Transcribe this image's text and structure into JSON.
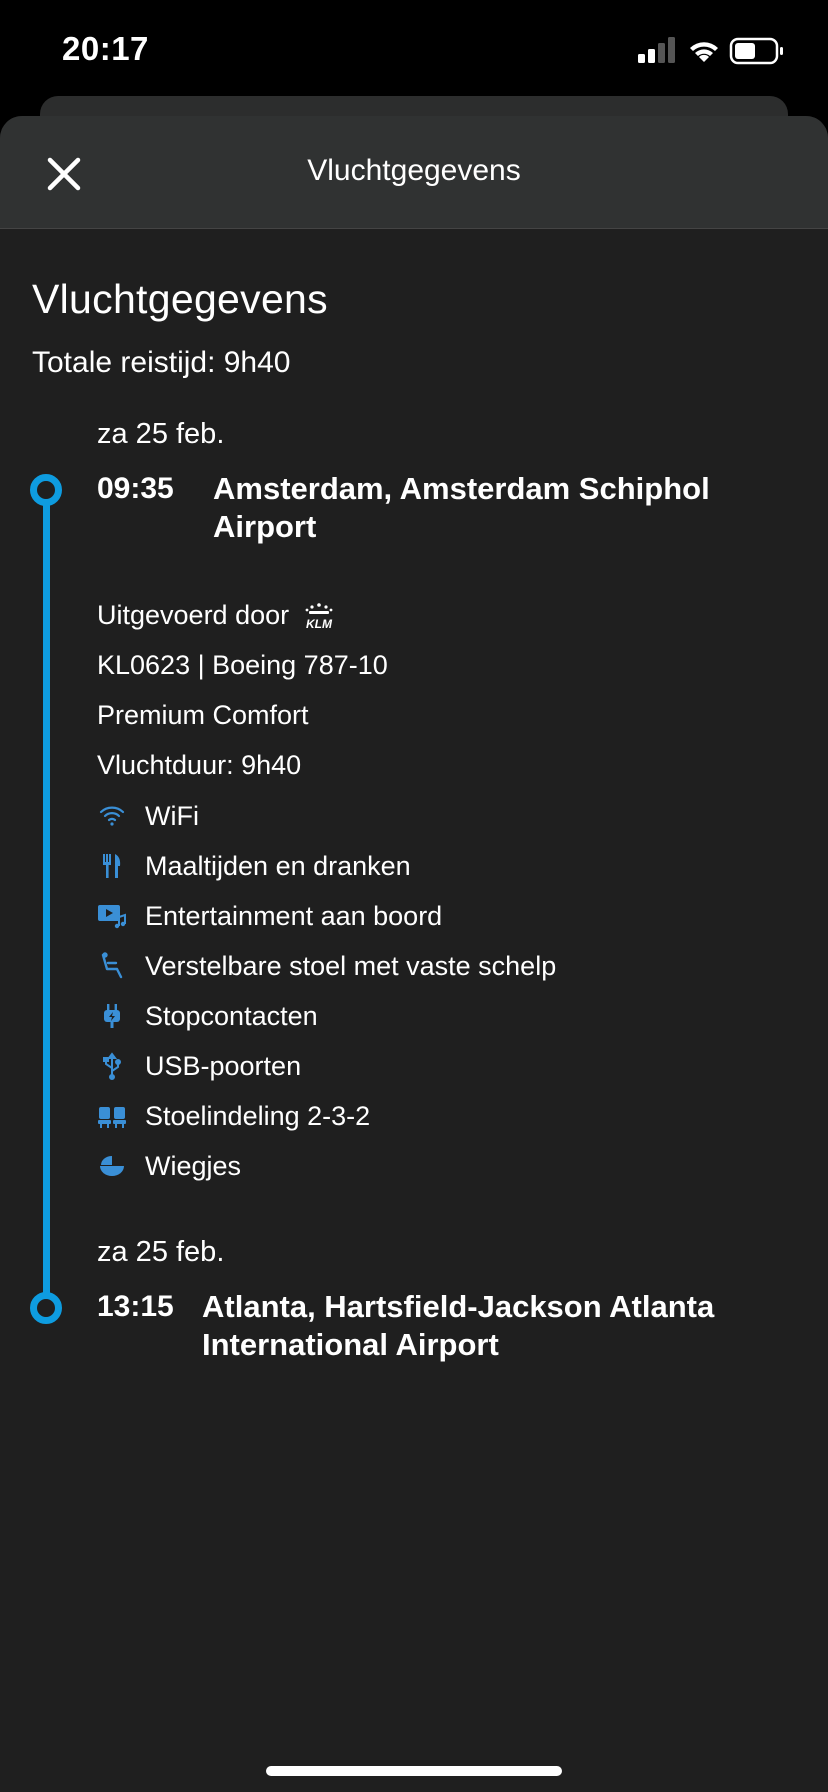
{
  "status_bar": {
    "time": "20:17"
  },
  "nav": {
    "title": "Vluchtgegevens"
  },
  "page": {
    "title": "Vluchtgegevens",
    "total_travel_time": "Totale reistijd: 9h40"
  },
  "departure": {
    "date": "za 25 feb.",
    "time": "09:35",
    "airport_line1": "Amsterdam, Amsterdam Schiphol",
    "airport_line2": "Airport"
  },
  "flight": {
    "operated_by": "Uitgevoerd door",
    "flight_and_aircraft": "KL0623 | Boeing 787-10",
    "cabin": "Premium Comfort",
    "duration": "Vluchtduur: 9h40"
  },
  "amenities": [
    {
      "icon": "wifi-icon",
      "label": "WiFi"
    },
    {
      "icon": "cutlery-icon",
      "label": "Maaltijden en dranken"
    },
    {
      "icon": "entertainment-icon",
      "label": "Entertainment aan boord"
    },
    {
      "icon": "reclining-seat-icon",
      "label": "Verstelbare stoel met vaste schelp"
    },
    {
      "icon": "power-plug-icon",
      "label": "Stopcontacten"
    },
    {
      "icon": "usb-icon",
      "label": "USB-poorten"
    },
    {
      "icon": "seat-layout-icon",
      "label": "Stoelindeling 2-3-2"
    },
    {
      "icon": "bassinet-icon",
      "label": "Wiegjes"
    }
  ],
  "arrival": {
    "date": "za 25 feb.",
    "time": "13:15",
    "airport_line1": "Atlanta, Hartsfield-Jackson Atlanta",
    "airport_line2": "International Airport"
  },
  "colors": {
    "accent": "#0e9ce0",
    "background": "#1f1f1f",
    "nav_background": "#303232",
    "icon_blue": "#3a8fd6"
  }
}
